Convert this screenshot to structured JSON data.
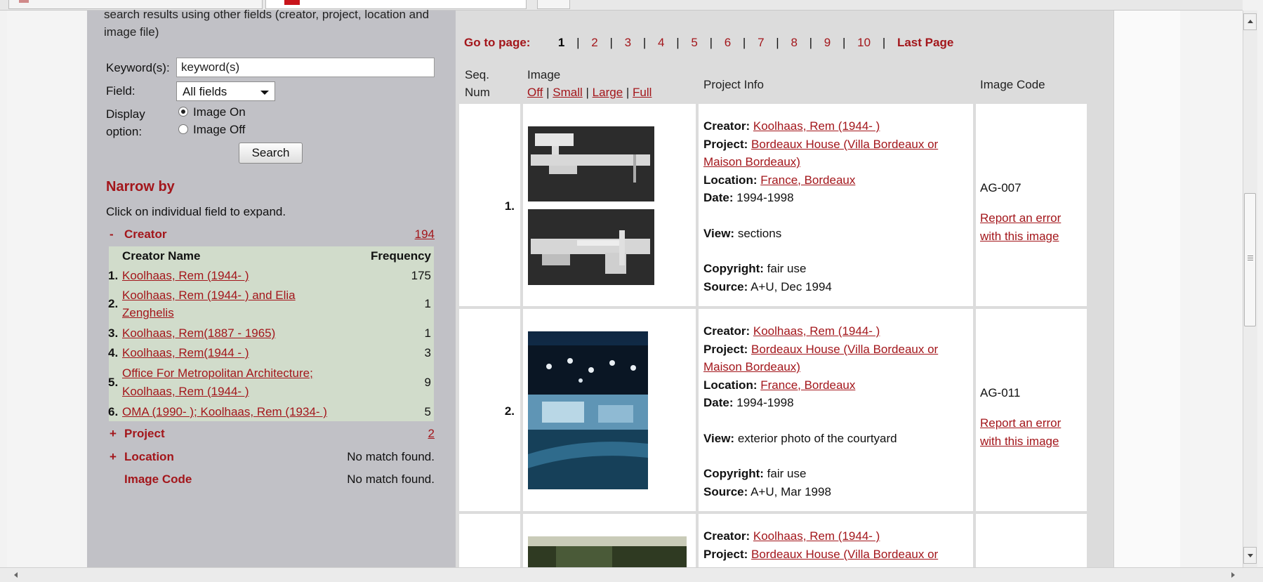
{
  "intro_text": "search results using other fields (creator, project, location and image file)",
  "search": {
    "keyword_label": "Keyword(s):",
    "keyword_value": "keyword(s)",
    "field_label": "Field:",
    "field_value": "All fields",
    "display_label": "Display option:",
    "image_on": "Image On",
    "image_off": "Image Off",
    "button": "Search"
  },
  "narrow": {
    "title": "Narrow by",
    "help": "Click on individual field to expand.",
    "creator_facet": {
      "sym": "-",
      "label": "Creator",
      "count": "194"
    },
    "creator_table": {
      "head_name": "Creator Name",
      "head_freq": "Frequency",
      "rows": [
        {
          "num": "1.",
          "name": "Koolhaas, Rem (1944- )",
          "freq": "175"
        },
        {
          "num": "2.",
          "name_line1": "Koolhaas, Rem (1944- ) and Elia",
          "name_line2": "Zenghelis",
          "freq": "1"
        },
        {
          "num": "3.",
          "name": "Koolhaas, Rem(1887 - 1965)",
          "freq": "1"
        },
        {
          "num": "4.",
          "name": "Koolhaas, Rem(1944 - )",
          "freq": "3"
        },
        {
          "num": "5.",
          "name_line1": "Office For Metropolitan Architecture;",
          "name_line2": "Koolhaas, Rem (1944- )",
          "freq": "9"
        },
        {
          "num": "6.",
          "name": "OMA (1990- ); Koolhaas, Rem (1934- )",
          "freq": "5"
        }
      ]
    },
    "project_facet": {
      "sym": "+",
      "label": "Project",
      "count": "2"
    },
    "location_facet": {
      "sym": "+",
      "label": "Location",
      "count": "No match found."
    },
    "imagecode_facet": {
      "sym": "",
      "label": "Image Code",
      "count": "No match found."
    }
  },
  "pager": {
    "label": "Go to page:",
    "current": "1",
    "pages": [
      "2",
      "3",
      "4",
      "5",
      "6",
      "7",
      "8",
      "9",
      "10"
    ],
    "last": "Last Page",
    "sep": "|"
  },
  "table_head": {
    "seq_line1": "Seq.",
    "seq_line2": "Num",
    "image": "Image",
    "off": "Off",
    "small": "Small",
    "large": "Large",
    "full": "Full",
    "bar": "|",
    "project_info": "Project Info",
    "image_code": "Image Code"
  },
  "labels": {
    "creator": "Creator:",
    "project": "Project:",
    "location": "Location:",
    "date": "Date:",
    "view": "View:",
    "copyright": "Copyright:",
    "source": "Source:",
    "report_line1": "Report an error",
    "report_line2": "with this image"
  },
  "results": [
    {
      "seq": "1.",
      "creator": "Koolhaas, Rem (1944- )",
      "project_line1": "Bordeaux House (Villa Bordeaux or",
      "project_line2": "Maison Bordeaux)",
      "location": "France, Bordeaux",
      "date": "1994-1998",
      "view": "sections",
      "copyright": "fair use",
      "source": "A+U, Dec 1994",
      "code": "AG-007"
    },
    {
      "seq": "2.",
      "creator": "Koolhaas, Rem (1944- )",
      "project_line1": "Bordeaux House (Villa Bordeaux or",
      "project_line2": "Maison Bordeaux)",
      "location": "France, Bordeaux",
      "date": "1994-1998",
      "view": "exterior photo of the courtyard",
      "copyright": "fair use",
      "source": "A+U, Mar 1998",
      "code": "AG-011"
    },
    {
      "seq": "",
      "creator": "Koolhaas, Rem (1944- )",
      "project_line1": "Bordeaux House (Villa Bordeaux or"
    }
  ]
}
